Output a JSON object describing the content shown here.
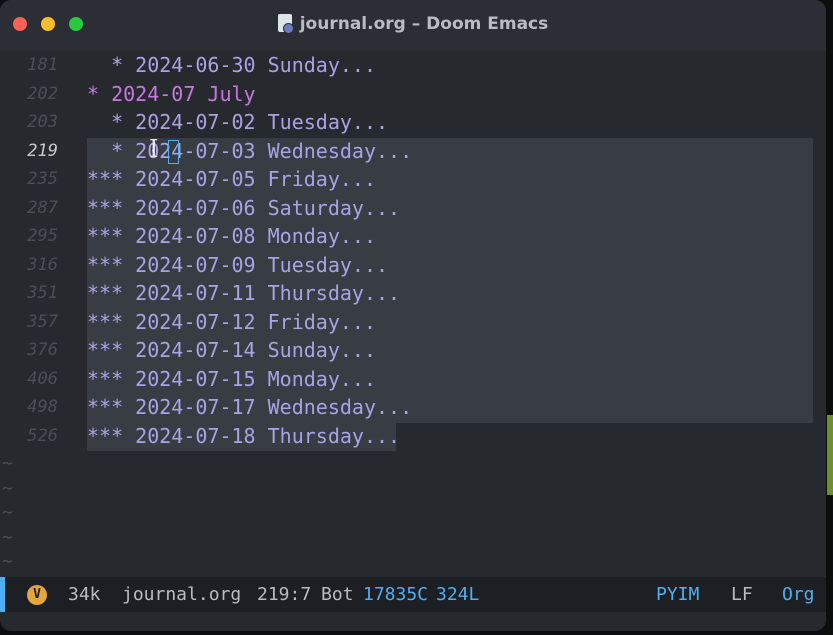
{
  "window": {
    "title": "journal.org – Doom Emacs"
  },
  "editor": {
    "lines": [
      {
        "num": "181",
        "indent": "  ",
        "stars": "*",
        "text": " 2024-06-30 Sunday...",
        "level": 2
      },
      {
        "num": "202",
        "indent": "",
        "stars": "*",
        "text": " 2024-07 July",
        "level": 1
      },
      {
        "num": "203",
        "indent": "  ",
        "stars": "*",
        "text": " 2024-07-02 Tuesday...",
        "level": 2
      },
      {
        "num": "219",
        "indent": "  ",
        "stars": "*",
        "text": " 2024-07-03 Wednesday...",
        "level": 2,
        "current": true
      },
      {
        "num": "235",
        "indent": "",
        "stars": "***",
        "text": " 2024-07-05 Friday...",
        "level": 3
      },
      {
        "num": "287",
        "indent": "",
        "stars": "***",
        "text": " 2024-07-06 Saturday...",
        "level": 3
      },
      {
        "num": "295",
        "indent": "",
        "stars": "***",
        "text": " 2024-07-08 Monday...",
        "level": 3
      },
      {
        "num": "316",
        "indent": "",
        "stars": "***",
        "text": " 2024-07-09 Tuesday...",
        "level": 3
      },
      {
        "num": "351",
        "indent": "",
        "stars": "***",
        "text": " 2024-07-11 Thursday...",
        "level": 3
      },
      {
        "num": "357",
        "indent": "",
        "stars": "***",
        "text": " 2024-07-12 Friday...",
        "level": 3
      },
      {
        "num": "376",
        "indent": "",
        "stars": "***",
        "text": " 2024-07-14 Sunday...",
        "level": 3
      },
      {
        "num": "406",
        "indent": "",
        "stars": "***",
        "text": " 2024-07-15 Monday...",
        "level": 3
      },
      {
        "num": "498",
        "indent": "",
        "stars": "***",
        "text": " 2024-07-17 Wednesday...",
        "level": 3
      },
      {
        "num": "526",
        "indent": "",
        "stars": "***",
        "text": " 2024-07-18 Thursday...",
        "level": 3
      }
    ],
    "tildes": [
      "~",
      "~",
      "~",
      "~",
      "~"
    ]
  },
  "modeline": {
    "state_badge": "V",
    "size": "34k",
    "buffer": "journal.org",
    "position": "219:7",
    "scroll": "Bot",
    "chars": "17835C",
    "lines": "324L",
    "input_method": "PYIM",
    "eol": "LF",
    "mode": "Org"
  },
  "colors": {
    "background": "#262a2f",
    "heading_level1": "#c678dd",
    "heading_other": "#a9a3e6",
    "accent": "#51afef",
    "selection": "#383c43"
  }
}
